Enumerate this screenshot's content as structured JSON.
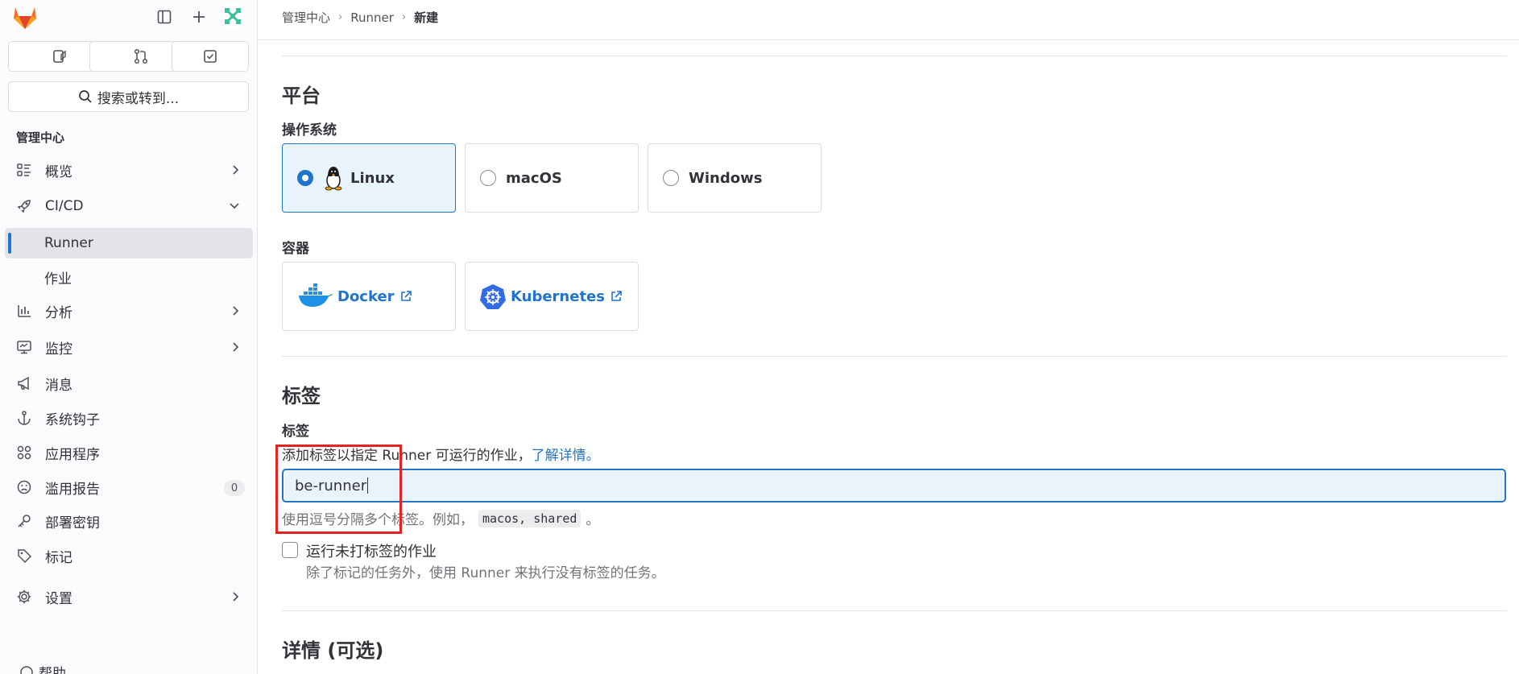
{
  "sidebar": {
    "section_title": "管理中心",
    "search_label": "搜索或转到...",
    "items": [
      {
        "label": "概览",
        "icon": "overview-icon"
      },
      {
        "label": "CI/CD",
        "icon": "rocket-icon"
      },
      {
        "label": "Runner"
      },
      {
        "label": "作业"
      },
      {
        "label": "分析",
        "icon": "chart-icon"
      },
      {
        "label": "监控",
        "icon": "monitor-icon"
      },
      {
        "label": "消息",
        "icon": "bullhorn-icon"
      },
      {
        "label": "系统钩子",
        "icon": "anchor-icon"
      },
      {
        "label": "应用程序",
        "icon": "applications-icon"
      },
      {
        "label": "滥用报告",
        "icon": "frown-icon",
        "badge": "0"
      },
      {
        "label": "部署密钥",
        "icon": "key-icon"
      },
      {
        "label": "标记",
        "icon": "label-icon"
      },
      {
        "label": "设置",
        "icon": "gear-icon"
      }
    ],
    "help_label": "帮助"
  },
  "breadcrumb": [
    "管理中心",
    "Runner",
    "新建"
  ],
  "platform": {
    "heading": "平台",
    "os_label": "操作系统",
    "os_options": [
      "Linux",
      "macOS",
      "Windows"
    ],
    "selected": "Linux",
    "container_label": "容器",
    "containers": [
      "Docker",
      "Kubernetes"
    ]
  },
  "tags": {
    "heading": "标签",
    "field_label": "标签",
    "description": "添加标签以指定 Runner 可运行的作业，",
    "learn_more": "了解详情。",
    "value": "be-runner",
    "hint_prefix": "使用逗号分隔多个标签。例如，",
    "hint_example": "macos, shared",
    "hint_suffix": "。",
    "untagged_label": "运行未打标签的作业",
    "untagged_help": "除了标记的任务外，使用 Runner 来执行没有标签的任务。"
  },
  "details": {
    "heading": "详情 (可选)"
  },
  "colors": {
    "accent": "#1f75cb",
    "annotation": "#e52222"
  }
}
